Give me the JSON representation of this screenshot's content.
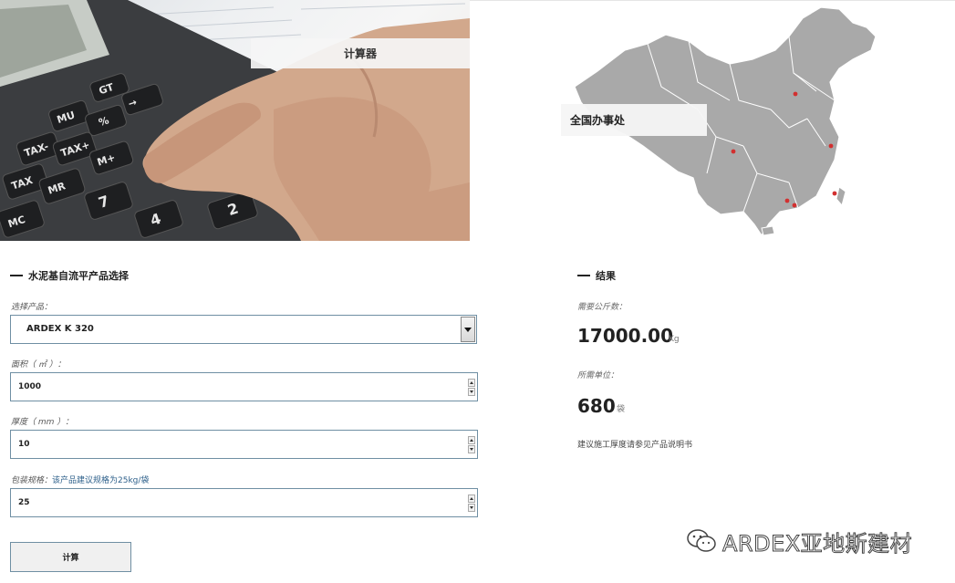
{
  "hero": {
    "label": "计算器"
  },
  "map": {
    "label": "全国办事处"
  },
  "product_section": {
    "title": "水泥基自流平产品选择"
  },
  "form": {
    "product": {
      "label": "选择产品：",
      "value": "ARDEX K 320"
    },
    "area": {
      "label": "面积（ ㎡ ）：",
      "value": "1000"
    },
    "thickness": {
      "label": "厚度（ mm ）：",
      "value": "10"
    },
    "package": {
      "label": "包装规格：",
      "help": "该产品建议规格为25kg/袋",
      "value": "25"
    },
    "calculate_label": "计算"
  },
  "results_section": {
    "title": "结果"
  },
  "results": {
    "kg_label": "需要公斤数：",
    "kg_value": "17000.00",
    "kg_unit": "Kg",
    "bags_label": "所需单位：",
    "bags_value": "680",
    "bags_unit": "袋",
    "note": "建议施工厚度请参见产品说明书"
  },
  "watermark": {
    "text": "ARDEX亚地斯建材"
  },
  "colors": {
    "input_border": "#6f8fa3",
    "map_fill": "#a9a9a9",
    "office_marker": "#d23030",
    "help_text": "#2c5f8a"
  }
}
